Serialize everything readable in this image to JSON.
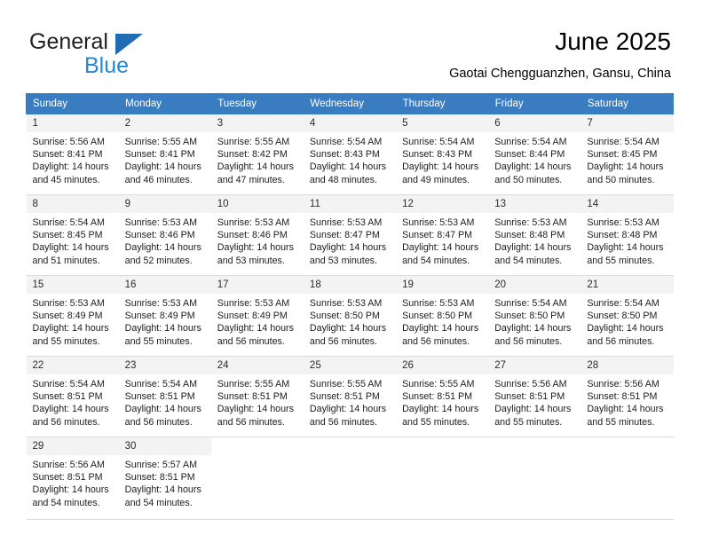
{
  "brand": {
    "name_part1": "General",
    "name_part2": "Blue",
    "triangle_color": "#1f6cb4",
    "blue_color": "#2486d0"
  },
  "header": {
    "title": "June 2025",
    "location": "Gaotai Chengguanzhen, Gansu, China"
  },
  "theme": {
    "header_bg": "#3a7cc0",
    "header_text": "#ffffff",
    "daynum_bg": "#f3f3f3",
    "grid_border": "#dcdcdc"
  },
  "weekday_headers": [
    "Sunday",
    "Monday",
    "Tuesday",
    "Wednesday",
    "Thursday",
    "Friday",
    "Saturday"
  ],
  "weeks": [
    [
      {
        "day": "1",
        "sunrise": "Sunrise: 5:56 AM",
        "sunset": "Sunset: 8:41 PM",
        "daylight_1": "Daylight: 14 hours",
        "daylight_2": "and 45 minutes."
      },
      {
        "day": "2",
        "sunrise": "Sunrise: 5:55 AM",
        "sunset": "Sunset: 8:41 PM",
        "daylight_1": "Daylight: 14 hours",
        "daylight_2": "and 46 minutes."
      },
      {
        "day": "3",
        "sunrise": "Sunrise: 5:55 AM",
        "sunset": "Sunset: 8:42 PM",
        "daylight_1": "Daylight: 14 hours",
        "daylight_2": "and 47 minutes."
      },
      {
        "day": "4",
        "sunrise": "Sunrise: 5:54 AM",
        "sunset": "Sunset: 8:43 PM",
        "daylight_1": "Daylight: 14 hours",
        "daylight_2": "and 48 minutes."
      },
      {
        "day": "5",
        "sunrise": "Sunrise: 5:54 AM",
        "sunset": "Sunset: 8:43 PM",
        "daylight_1": "Daylight: 14 hours",
        "daylight_2": "and 49 minutes."
      },
      {
        "day": "6",
        "sunrise": "Sunrise: 5:54 AM",
        "sunset": "Sunset: 8:44 PM",
        "daylight_1": "Daylight: 14 hours",
        "daylight_2": "and 50 minutes."
      },
      {
        "day": "7",
        "sunrise": "Sunrise: 5:54 AM",
        "sunset": "Sunset: 8:45 PM",
        "daylight_1": "Daylight: 14 hours",
        "daylight_2": "and 50 minutes."
      }
    ],
    [
      {
        "day": "8",
        "sunrise": "Sunrise: 5:54 AM",
        "sunset": "Sunset: 8:45 PM",
        "daylight_1": "Daylight: 14 hours",
        "daylight_2": "and 51 minutes."
      },
      {
        "day": "9",
        "sunrise": "Sunrise: 5:53 AM",
        "sunset": "Sunset: 8:46 PM",
        "daylight_1": "Daylight: 14 hours",
        "daylight_2": "and 52 minutes."
      },
      {
        "day": "10",
        "sunrise": "Sunrise: 5:53 AM",
        "sunset": "Sunset: 8:46 PM",
        "daylight_1": "Daylight: 14 hours",
        "daylight_2": "and 53 minutes."
      },
      {
        "day": "11",
        "sunrise": "Sunrise: 5:53 AM",
        "sunset": "Sunset: 8:47 PM",
        "daylight_1": "Daylight: 14 hours",
        "daylight_2": "and 53 minutes."
      },
      {
        "day": "12",
        "sunrise": "Sunrise: 5:53 AM",
        "sunset": "Sunset: 8:47 PM",
        "daylight_1": "Daylight: 14 hours",
        "daylight_2": "and 54 minutes."
      },
      {
        "day": "13",
        "sunrise": "Sunrise: 5:53 AM",
        "sunset": "Sunset: 8:48 PM",
        "daylight_1": "Daylight: 14 hours",
        "daylight_2": "and 54 minutes."
      },
      {
        "day": "14",
        "sunrise": "Sunrise: 5:53 AM",
        "sunset": "Sunset: 8:48 PM",
        "daylight_1": "Daylight: 14 hours",
        "daylight_2": "and 55 minutes."
      }
    ],
    [
      {
        "day": "15",
        "sunrise": "Sunrise: 5:53 AM",
        "sunset": "Sunset: 8:49 PM",
        "daylight_1": "Daylight: 14 hours",
        "daylight_2": "and 55 minutes."
      },
      {
        "day": "16",
        "sunrise": "Sunrise: 5:53 AM",
        "sunset": "Sunset: 8:49 PM",
        "daylight_1": "Daylight: 14 hours",
        "daylight_2": "and 55 minutes."
      },
      {
        "day": "17",
        "sunrise": "Sunrise: 5:53 AM",
        "sunset": "Sunset: 8:49 PM",
        "daylight_1": "Daylight: 14 hours",
        "daylight_2": "and 56 minutes."
      },
      {
        "day": "18",
        "sunrise": "Sunrise: 5:53 AM",
        "sunset": "Sunset: 8:50 PM",
        "daylight_1": "Daylight: 14 hours",
        "daylight_2": "and 56 minutes."
      },
      {
        "day": "19",
        "sunrise": "Sunrise: 5:53 AM",
        "sunset": "Sunset: 8:50 PM",
        "daylight_1": "Daylight: 14 hours",
        "daylight_2": "and 56 minutes."
      },
      {
        "day": "20",
        "sunrise": "Sunrise: 5:54 AM",
        "sunset": "Sunset: 8:50 PM",
        "daylight_1": "Daylight: 14 hours",
        "daylight_2": "and 56 minutes."
      },
      {
        "day": "21",
        "sunrise": "Sunrise: 5:54 AM",
        "sunset": "Sunset: 8:50 PM",
        "daylight_1": "Daylight: 14 hours",
        "daylight_2": "and 56 minutes."
      }
    ],
    [
      {
        "day": "22",
        "sunrise": "Sunrise: 5:54 AM",
        "sunset": "Sunset: 8:51 PM",
        "daylight_1": "Daylight: 14 hours",
        "daylight_2": "and 56 minutes."
      },
      {
        "day": "23",
        "sunrise": "Sunrise: 5:54 AM",
        "sunset": "Sunset: 8:51 PM",
        "daylight_1": "Daylight: 14 hours",
        "daylight_2": "and 56 minutes."
      },
      {
        "day": "24",
        "sunrise": "Sunrise: 5:55 AM",
        "sunset": "Sunset: 8:51 PM",
        "daylight_1": "Daylight: 14 hours",
        "daylight_2": "and 56 minutes."
      },
      {
        "day": "25",
        "sunrise": "Sunrise: 5:55 AM",
        "sunset": "Sunset: 8:51 PM",
        "daylight_1": "Daylight: 14 hours",
        "daylight_2": "and 56 minutes."
      },
      {
        "day": "26",
        "sunrise": "Sunrise: 5:55 AM",
        "sunset": "Sunset: 8:51 PM",
        "daylight_1": "Daylight: 14 hours",
        "daylight_2": "and 55 minutes."
      },
      {
        "day": "27",
        "sunrise": "Sunrise: 5:56 AM",
        "sunset": "Sunset: 8:51 PM",
        "daylight_1": "Daylight: 14 hours",
        "daylight_2": "and 55 minutes."
      },
      {
        "day": "28",
        "sunrise": "Sunrise: 5:56 AM",
        "sunset": "Sunset: 8:51 PM",
        "daylight_1": "Daylight: 14 hours",
        "daylight_2": "and 55 minutes."
      }
    ],
    [
      {
        "day": "29",
        "sunrise": "Sunrise: 5:56 AM",
        "sunset": "Sunset: 8:51 PM",
        "daylight_1": "Daylight: 14 hours",
        "daylight_2": "and 54 minutes."
      },
      {
        "day": "30",
        "sunrise": "Sunrise: 5:57 AM",
        "sunset": "Sunset: 8:51 PM",
        "daylight_1": "Daylight: 14 hours",
        "daylight_2": "and 54 minutes."
      },
      {
        "day": "",
        "sunrise": "",
        "sunset": "",
        "daylight_1": "",
        "daylight_2": ""
      },
      {
        "day": "",
        "sunrise": "",
        "sunset": "",
        "daylight_1": "",
        "daylight_2": ""
      },
      {
        "day": "",
        "sunrise": "",
        "sunset": "",
        "daylight_1": "",
        "daylight_2": ""
      },
      {
        "day": "",
        "sunrise": "",
        "sunset": "",
        "daylight_1": "",
        "daylight_2": ""
      },
      {
        "day": "",
        "sunrise": "",
        "sunset": "",
        "daylight_1": "",
        "daylight_2": ""
      }
    ]
  ]
}
